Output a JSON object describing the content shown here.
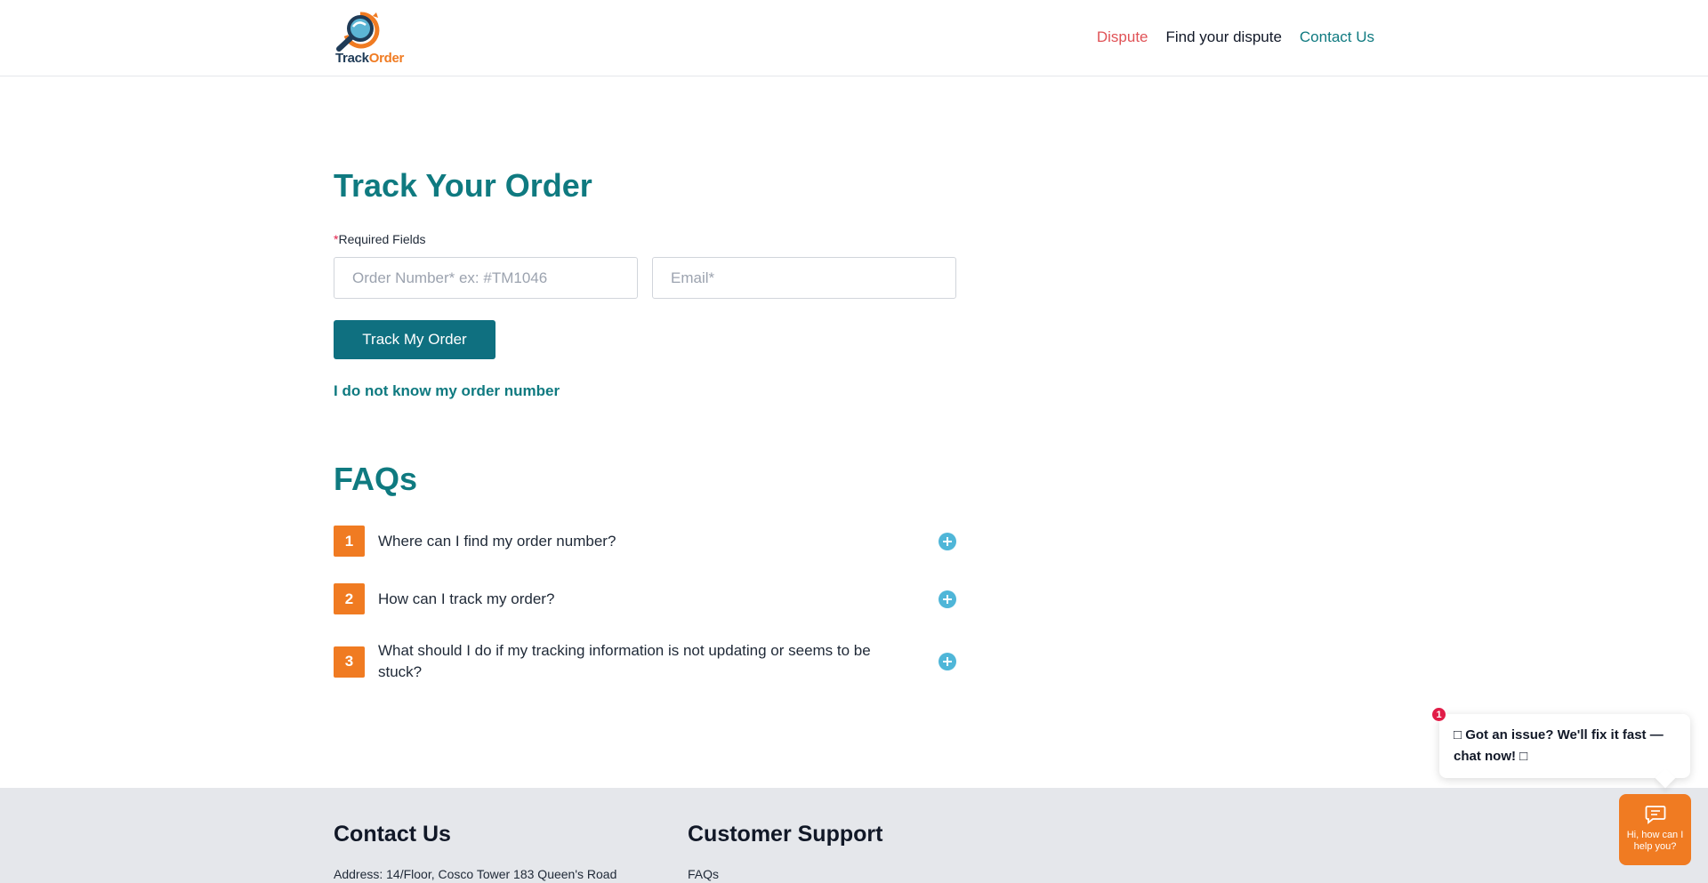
{
  "header": {
    "logo": {
      "text_track": "Track",
      "text_order": "Order",
      "icon": "magnifier-globe-icon"
    },
    "nav": [
      {
        "label": "Dispute",
        "color": "#e05256"
      },
      {
        "label": "Find your dispute",
        "color": "#111827"
      },
      {
        "label": "Contact Us",
        "color": "#0f7a80"
      }
    ]
  },
  "main": {
    "title": "Track Your Order",
    "required_star": "*",
    "required_label": "Required Fields",
    "order_input": {
      "value": "",
      "placeholder": "Order Number* ex: #TM1046"
    },
    "email_input": {
      "value": "",
      "placeholder": "Email*"
    },
    "track_button": "Track My Order",
    "forgot_link": "I do not know my order number"
  },
  "faqs": {
    "title": "FAQs",
    "items": [
      {
        "num": "1",
        "question": "Where can I find my order number?"
      },
      {
        "num": "2",
        "question": "How can I track my order?"
      },
      {
        "num": "3",
        "question": "What should I do if my tracking information is not updating or seems to be stuck?"
      }
    ],
    "expand_icon": "plus-circle-icon"
  },
  "footer": {
    "contact_title": "Contact Us",
    "address": "Address: 14/Floor, Cosco Tower 183 Queen's Road",
    "support_title": "Customer Support",
    "faqs_link": "FAQs"
  },
  "chat": {
    "badge": "1",
    "bubble_text": "□ Got an issue? We'll fix it fast — chat now! □",
    "launcher_label": "Hi, how can I help you?",
    "icon": "chat-message-icon"
  },
  "colors": {
    "brand_teal": "#0f7a80",
    "brand_orange": "#f07b22",
    "button_teal": "#0f7080"
  }
}
